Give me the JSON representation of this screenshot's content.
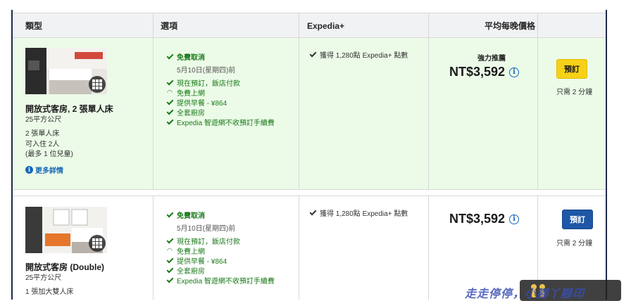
{
  "header": {
    "col_type": "類型",
    "col_options": "選項",
    "col_expedia": "Expedia+",
    "col_price": "平均每晚價格"
  },
  "rooms": [
    {
      "name": "開放式客房, 2 張單人床",
      "size": "25平方公尺",
      "bed": "2 張單人床",
      "occupancy": "可入住 2人",
      "children": "(最多 1 位兒童)",
      "more_details": "更多詳情",
      "options": {
        "free_cancel": "免費取消",
        "cancel_by": "5月10日(星期四)前",
        "pay_at_hotel": "現在預訂，飯店付款",
        "wifi": "免費上網",
        "breakfast": "提供早餐 - ¥864",
        "kitchen": "全套廚房",
        "no_fee": "Expedia 智遊網不收預訂手續費"
      },
      "expedia_points": "獲得 1,280點 Expedia+ 點數",
      "recommended": "強力推薦",
      "price": "NT$3,592",
      "book_label": "預訂",
      "book_time": "只需 2 分鐘",
      "book_color": "#f7d118"
    },
    {
      "name": "開放式客房 (Double)",
      "size": "25平方公尺",
      "bed": "1 張加大雙人床",
      "options": {
        "free_cancel": "免費取消",
        "cancel_by": "5月10日(星期四)前",
        "pay_at_hotel": "現在預訂，飯店付款",
        "wifi": "免費上網",
        "breakfast": "提供早餐 - ¥864",
        "kitchen": "全套廚房",
        "no_fee": "Expedia 智遊網不收預訂手續費"
      },
      "expedia_points": "獲得 1,280點 Expedia+ 點數",
      "price": "NT$3,592",
      "book_label": "預訂",
      "book_time": "只需 2 分鐘",
      "book_color": "#1d57a6"
    }
  ],
  "watermark": "走走停停，小腳丫腳印",
  "icons": {
    "gallery": "gallery-grid-icon",
    "info": "info-icon",
    "check": "check-icon",
    "wifi": "wifi-icon"
  },
  "colors": {
    "recommended_row_bg": "#ecfbe8",
    "option_green": "#1b7a1b",
    "link_blue": "#1668b8"
  }
}
